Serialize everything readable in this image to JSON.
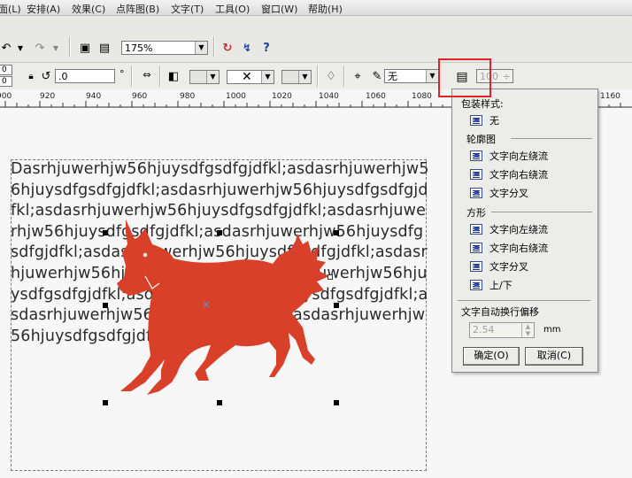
{
  "menu": [
    "面(L)",
    "安排(A)",
    "效果(C)",
    "点阵图(B)",
    "文字(T)",
    "工具(O)",
    "窗口(W)",
    "帮助(H)"
  ],
  "toolbar": {
    "zoom_value": "175%",
    "pos_x": "0",
    "pos_y": "0",
    "rotate_value": ".0",
    "degree_symbol": "°",
    "outline_value": "无",
    "offset_value": "100"
  },
  "ruler": {
    "labels": [
      "900",
      "920",
      "940",
      "960",
      "980",
      "1000",
      "1020",
      "1040",
      "1060",
      "1080",
      "1160"
    ]
  },
  "body_text": "Dasrhjuwerhjw56hjuysdfgsdfgjdfkl;asdasrhjuwerhjw56hjuysdfgsdfgjdfkl;asdasrhjuwerhjw56hjuysdfgsdfgjdfkl;asdasrhjuwerhjw56hjuysdfgsdfgjdfkl;asdasrhjuwerhjw56hjuysdfgsdfgjdfkl;asdasrhjuwerhjw56hjuysdfgsdfgjdfkl;asdasrhjuwerhjw56hjuysdfgsdfgjdfkl;asdasrhjuwerhjw56hjuysdfgsdfgjdfkl;asdasrhjuwerhjw56hjuysdfgsdfgjdfkl;asdasrhjuwerhjw56hjuysdfgsdfgjdfkl;asdasrhjuwerhjw56hjuysdfgsdfgjdfkl;asdasrhjuwerhjw56hjuysdfgsdfgjdfkl;as",
  "panel": {
    "title": "包装样式:",
    "none_label": "无",
    "contour_title": "轮廓图",
    "contour_options": [
      "文字向左绕流",
      "文字向右绕流",
      "文字分叉"
    ],
    "square_title": "方形",
    "square_options": [
      "文字向左绕流",
      "文字向右绕流",
      "文字分叉",
      "上/下"
    ],
    "offset_title": "文字自动换行偏移",
    "offset_value": "2.54",
    "offset_unit": "mm",
    "ok_label": "确定(O)",
    "cancel_label": "取消(C)"
  },
  "colors": {
    "dog": "#d9402a",
    "highlight": "#e02424"
  }
}
